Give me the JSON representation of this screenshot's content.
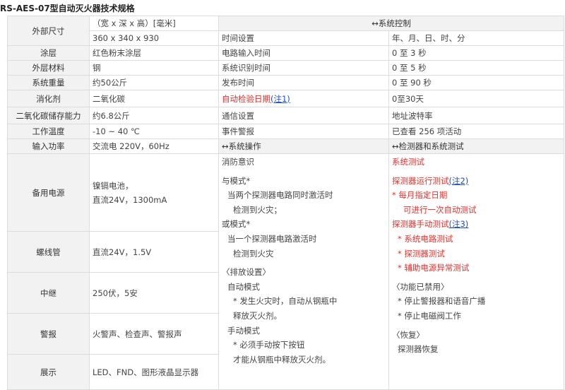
{
  "title": "RS-AES-07型自动灭火器技术规格",
  "left": {
    "size_label": "外部尺寸",
    "size_units": "（宽 x 深 x 高）[毫米]",
    "size_value": "360 x 340 x 930",
    "coating_label": "涂层",
    "coating_value": "红色粉末涂层",
    "material_label": "外层材料",
    "material_value": "钢",
    "weight_label": "系统重量",
    "weight_value": "约50公斤",
    "agent_label": "消化剂",
    "agent_value": "二氧化碳",
    "capacity_label": "二氧化碳储存能力",
    "capacity_value": "约6.8公斤",
    "temp_label": "工作温度",
    "temp_value": "-10 ~ 40 ℃",
    "power_label": "输入功率",
    "power_value": "交流电 220V，60Hz",
    "backup_label": "备用电源",
    "backup_value_1": "镍镉电池，",
    "backup_value_2": "直流24V，1300mA",
    "solenoid_label": "螺线管",
    "solenoid_value": "直流24V，1.5V",
    "relay_label": "中继",
    "relay_value": "250伏，5安",
    "alarm_label": "警报",
    "alarm_value": "火警声、检查声、警报声",
    "display_label": "展示",
    "display_value": "LED、FND、图形液晶显示器"
  },
  "control": {
    "header": "↔系统控制",
    "rows": [
      {
        "name": "时间设置",
        "value": "年、月、日、时、分"
      },
      {
        "name": "电路输入时间",
        "value": "0 至 3 秒"
      },
      {
        "name": "系统识别时间",
        "value": "0 至 5 秒"
      },
      {
        "name": "发布时间",
        "value": "0 至 90 秒"
      },
      {
        "name": "自动检验日期",
        "note": "(注1)",
        "value": "0至30天"
      },
      {
        "name": "通信设置",
        "value": "地址波特率"
      },
      {
        "name": "事件警报",
        "value": "已查看 256 项活动"
      }
    ]
  },
  "operation": {
    "header": "↔系统操作",
    "fire_sense": "消防意识",
    "and_mode": "与模式*",
    "and_desc_1": "当两个探测器电路同时激活时",
    "and_desc_2": "检测到火灾；",
    "or_mode": "或模式*",
    "or_desc_1": "当一个探测器电路激活时",
    "or_desc_2": "检测到火灾",
    "release_header": "〈排放设置〉",
    "auto_mode": "自动模式",
    "auto_desc_1": "* 发生火灾时，自动从钢瓶中",
    "auto_desc_2": "释放灭火剂。",
    "manual_mode": "手动模式",
    "manual_desc_1": "* 必须手动按下按钮",
    "manual_desc_2": "才能从钢瓶中释放灭火剂。"
  },
  "test": {
    "header": "↔检测器和系统测试",
    "sys_test": "系统测试",
    "detector_run": "探测器运行测试",
    "note2": "(注2)",
    "monthly_1": "*   每月指定日期",
    "monthly_2": "可进行一次自动测试",
    "detector_manual": "探测器手动测试",
    "note3": "(注3)",
    "item_1": "* 系统电路测试",
    "item_2": "* 探测器测试",
    "item_3": "* 辅助电源异常测试",
    "disabled_header": "〈功能已禁用〉",
    "disabled_1": "* 停止警报器和语音广播",
    "disabled_2": "* 停止电磁阀工作",
    "recovery_header": "〈恢复〉",
    "recovery_1": "探测器恢复"
  }
}
